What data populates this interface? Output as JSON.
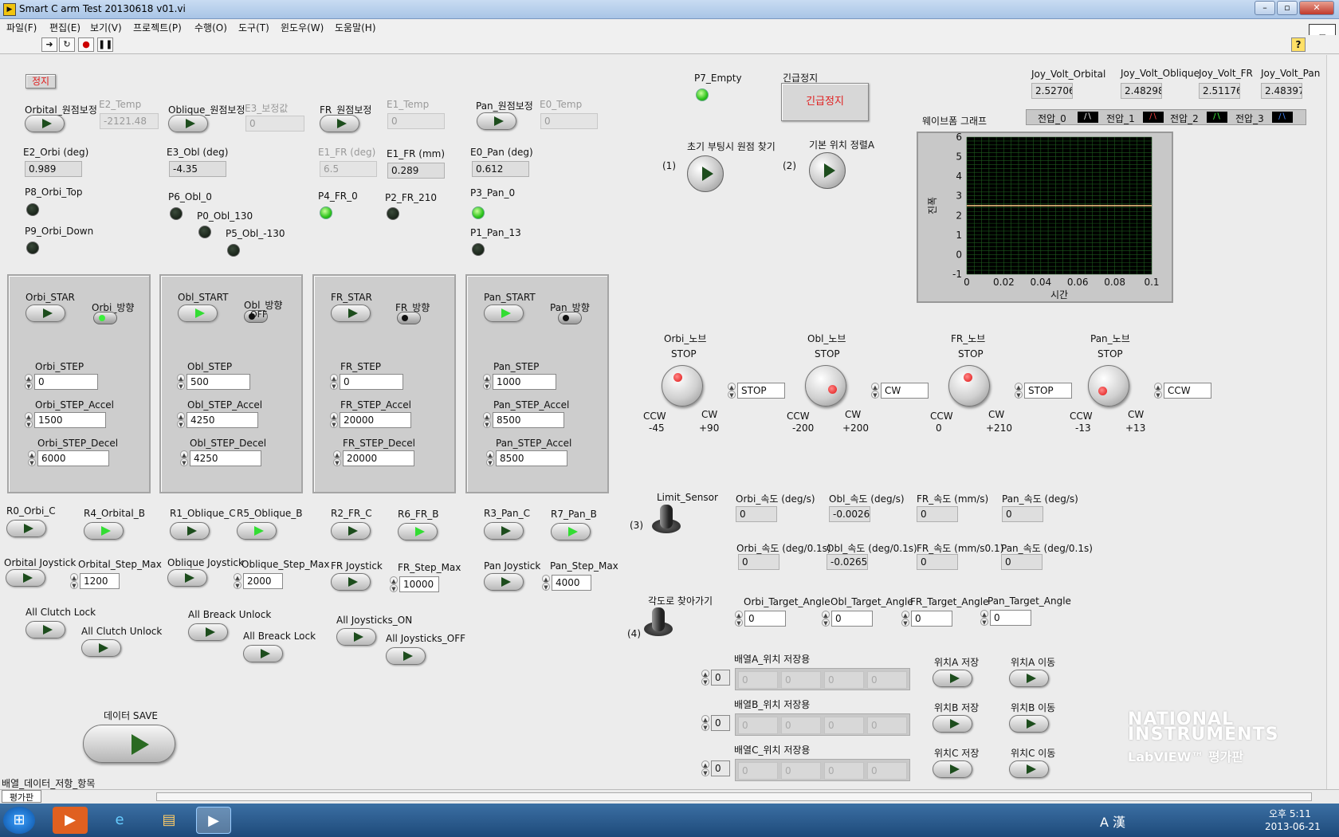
{
  "window": {
    "title": "Smart C arm Test 20130618 v01.vi"
  },
  "menu": [
    "파일(F)",
    "편집(E)",
    "보기(V)",
    "프로젝트(P)",
    "수행(O)",
    "도구(T)",
    "윈도우(W)",
    "도움말(H)"
  ],
  "stop_small": "정지",
  "zero": {
    "orbital": "Orbital_원점보정",
    "e2_temp_label": "E2_Temp",
    "e2_temp": "-2121.48",
    "oblique": "Oblique_원점보정",
    "e3_label": "E3_보정값",
    "e3": "0",
    "fr": "FR_원점보정",
    "e1_temp_label": "E1_Temp",
    "e1_temp": "0",
    "pan": "Pan_원점보정",
    "e0_temp_label": "E0_Temp",
    "e0_temp": "0"
  },
  "readouts": {
    "e2_orbi_label": "E2_Orbi (deg)",
    "e2_orbi": "0.989",
    "e3_obl_label": "E3_Obl (deg)",
    "e3_obl": "-4.35",
    "e1_fr_deg_label": "E1_FR (deg)",
    "e1_fr_deg": "6.5",
    "e1_fr_mm_label": "E1_FR (mm)",
    "e1_fr_mm": "0.289",
    "e0_pan_label": "E0_Pan (deg)",
    "e0_pan": "0.612"
  },
  "leds": {
    "p8": "P8_Orbi_Top",
    "p9": "P9_Orbi_Down",
    "p6": "P6_Obl_0",
    "p0": "P0_Obl_130",
    "p5": "P5_Obl_-130",
    "p4": "P4_FR_0",
    "p2": "P2_FR_210",
    "p3": "P3_Pan_0",
    "p1": "P1_Pan_13",
    "p7": "P7_Empty"
  },
  "axes": [
    {
      "start": "Orbi_STAR",
      "dir": "Orbi_방향",
      "step_label": "Orbi_STEP",
      "step": "0",
      "accel_label": "Orbi_STEP_Accel",
      "accel": "1500",
      "decel_label": "Orbi_STEP_Decel",
      "decel": "6000",
      "dir_text": ""
    },
    {
      "start": "Obl_START",
      "dir": "Obl_방향",
      "step_label": "Obl_STEP",
      "step": "500",
      "accel_label": "Obl_STEP_Accel",
      "accel": "4250",
      "decel_label": "Obl_STEP_Decel",
      "decel": "4250",
      "dir_text": "OFF"
    },
    {
      "start": "FR_STAR",
      "dir": "FR_방향",
      "step_label": "FR_STEP",
      "step": "0",
      "accel_label": "FR_STEP_Accel",
      "accel": "20000",
      "decel_label": "FR_STEP_Decel",
      "decel": "20000",
      "dir_text": ""
    },
    {
      "start": "Pan_START",
      "dir": "Pan_방향",
      "step_label": "Pan_STEP",
      "step": "1000",
      "accel_label": "Pan_STEP_Accel",
      "accel": "8500",
      "decel_label": "Pan_STEP_Accel",
      "decel": "8500",
      "dir_text": ""
    }
  ],
  "relays": {
    "r0": "R0_Orbi_C",
    "r4": "R4_Orbital_B",
    "r1": "R1_Oblique_C",
    "r5": "R5_Oblique_B",
    "r2": "R2_FR_C",
    "r6": "R6_FR_B",
    "r3": "R3_Pan_C",
    "r7": "R7_Pan_B"
  },
  "joysticks": {
    "orbital": "Orbital Joystick",
    "orbital_max_label": "Orbital_Step_Max",
    "orbital_max": "1200",
    "oblique": "Oblique Joystick",
    "oblique_max_label": "Oblique_Step_Max",
    "oblique_max": "2000",
    "fr": "FR Joystick",
    "fr_max_label": "FR_Step_Max",
    "fr_max": "10000",
    "pan": "Pan Joystick",
    "pan_max_label": "Pan_Step_Max",
    "pan_max": "4000"
  },
  "locks": {
    "clutch_lock": "All Clutch Lock",
    "clutch_unlock": "All Clutch Unlock",
    "breack_unlock": "All Breack Unlock",
    "breack_lock": "All Breack Lock",
    "joy_on": "All Joysticks_ON",
    "joy_off": "All Joysticks_OFF"
  },
  "save": {
    "label": "데이터 SAVE",
    "array_label": "배열_데이터_저항_항목"
  },
  "emergency": {
    "label": "긴급정지",
    "button": "긴급정지"
  },
  "home": {
    "label": "초기 부팅시 원점 찾기",
    "num": "(1)",
    "align_label": "기본 위치 정렬A",
    "align_num": "(2)"
  },
  "joyvolt": {
    "orbital_label": "Joy_Volt_Orbital",
    "orbital": "2.52706",
    "oblique_label": "Joy_Volt_Oblique",
    "oblique": "2.48298",
    "fr_label": "Joy_Volt_FR",
    "fr": "2.51176",
    "pan_label": "Joy_Volt_Pan",
    "pan": "2.48397"
  },
  "legend": [
    "전압_0",
    "전압_1",
    "전압_2",
    "전압_3"
  ],
  "chart_data": {
    "type": "line",
    "title": "웨이브폼 그래프",
    "xlabel": "시간",
    "ylabel": "진폭",
    "xlim": [
      0,
      0.1
    ],
    "ylim": [
      -1,
      6
    ],
    "xticks": [
      "0",
      "0.02",
      "0.04",
      "0.06",
      "0.08",
      "0.1"
    ],
    "yticks": [
      "6",
      "5",
      "4",
      "3",
      "2",
      "1",
      "0",
      "-1"
    ],
    "series": [
      {
        "name": "전압_0",
        "x": [
          0,
          0.1
        ],
        "y": [
          2.5,
          2.5
        ],
        "color": "#ffcc88"
      }
    ],
    "grid": true,
    "legend_position": "top"
  },
  "knobs": [
    {
      "label": "Orbi_노브",
      "stop": "STOP",
      "ccw": "CCW",
      "cw": "CW",
      "min": "-45",
      "max": "+90",
      "value": "STOP"
    },
    {
      "label": "Obl_노브",
      "stop": "STOP",
      "ccw": "CCW",
      "cw": "CW",
      "min": "-200",
      "max": "+200",
      "value": "CW"
    },
    {
      "label": "FR_노브",
      "stop": "STOP",
      "ccw": "CCW",
      "cw": "CW",
      "min": "0",
      "max": "+210",
      "value": "STOP"
    },
    {
      "label": "Pan_노브",
      "stop": "STOP",
      "ccw": "CCW",
      "cw": "CW",
      "min": "-13",
      "max": "+13",
      "value": "CCW"
    }
  ],
  "speed": {
    "limit_sensor": "Limit_Sensor",
    "num3": "(3)",
    "orbi_label": "Orbi_속도 (deg/s)",
    "orbi": "0",
    "obl_label": "Obl_속도 (deg/s)",
    "obl": "-0.0026",
    "fr_label": "FR_속도 (mm/s)",
    "fr": "0",
    "pan_label": "Pan_속도 (deg/s)",
    "pan": "0",
    "orbi01_label": "Orbi_속도 (deg/0.1s)",
    "orbi01": "0",
    "obl01_label": "Obl_속도 (deg/0.1s)",
    "obl01": "-0.0265",
    "fr01_label": "FR_속도 (mm/s0.1)",
    "fr01": "0",
    "pan01_label": "Pan_속도 (deg/0.1s)",
    "pan01": "0"
  },
  "target": {
    "go_label": "각도로 찾아가기",
    "num4": "(4)",
    "orbi_label": "Orbi_Target_Angle",
    "orbi": "0",
    "obl_label": "Obl_Target_Angle",
    "obl": "0",
    "fr_label": "FR_Target_Angle",
    "fr": "0",
    "pan_label": "Pan_Target_Angle",
    "pan": "0"
  },
  "positions": [
    {
      "label": "배열A_위치 저장용",
      "index": "0",
      "cells": [
        "0",
        "0",
        "0",
        "0"
      ],
      "save": "위치A 저장",
      "move": "위치A 이동"
    },
    {
      "label": "배열B_위치 저장용",
      "index": "0",
      "cells": [
        "0",
        "0",
        "0",
        "0"
      ],
      "save": "위치B 저장",
      "move": "위치B 이동"
    },
    {
      "label": "배열C_위치 저장용",
      "index": "0",
      "cells": [
        "0",
        "0",
        "0",
        "0"
      ],
      "save": "위치C 저장",
      "move": "위치C 이동"
    }
  ],
  "logo": {
    "line1": "NATIONAL",
    "line2": "INSTRUMENTS",
    "line3": "LabVIEW™ 평가판"
  },
  "status": {
    "eval": "평가판"
  },
  "clock": {
    "time": "오후 5:11",
    "date": "2013-06-21"
  },
  "ime": "A 漢"
}
